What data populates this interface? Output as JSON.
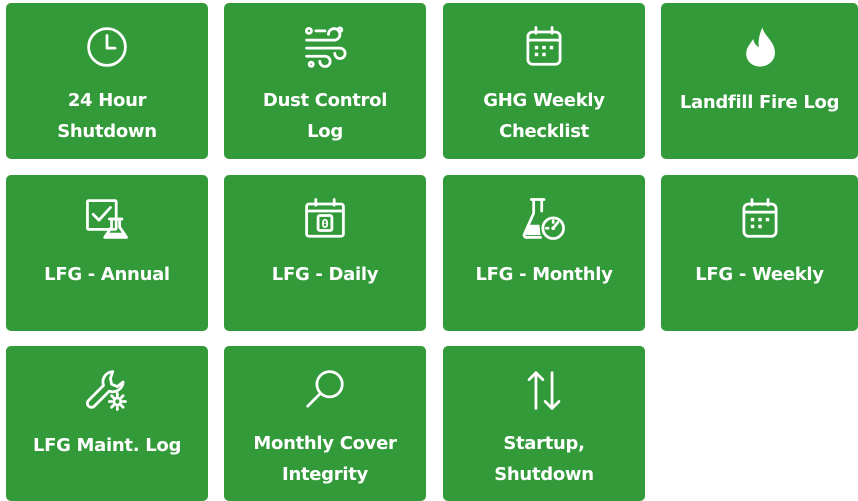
{
  "colors": {
    "tile_background": "#339a3a",
    "tile_text": "#ffffff",
    "page_background": "#ffffff"
  },
  "tiles": [
    {
      "label_line1": "24 Hour",
      "label_line2": "Shutdown",
      "icon": "clock-icon"
    },
    {
      "label_line1": "Dust Control",
      "label_line2": "Log",
      "icon": "wind-icon"
    },
    {
      "label_line1": "GHG Weekly",
      "label_line2": "Checklist",
      "icon": "calendar-icon"
    },
    {
      "label_line1": "Landfill Fire Log",
      "label_line2": "",
      "icon": "fire-icon"
    },
    {
      "label_line1": "LFG - Annual",
      "label_line2": "",
      "icon": "checklist-flask-icon"
    },
    {
      "label_line1": "LFG - Daily",
      "label_line2": "",
      "icon": "calendar-day-icon"
    },
    {
      "label_line1": "LFG - Monthly",
      "label_line2": "",
      "icon": "flask-gauge-icon"
    },
    {
      "label_line1": "LFG - Weekly",
      "label_line2": "",
      "icon": "calendar-icon"
    },
    {
      "label_line1": "LFG Maint. Log",
      "label_line2": "",
      "icon": "wrench-gear-icon"
    },
    {
      "label_line1": "Monthly Cover",
      "label_line2": "Integrity",
      "icon": "search-icon"
    },
    {
      "label_line1": "Startup,",
      "label_line2": "Shutdown",
      "icon": "up-down-arrows-icon"
    }
  ],
  "daily_calendar_number": "0"
}
